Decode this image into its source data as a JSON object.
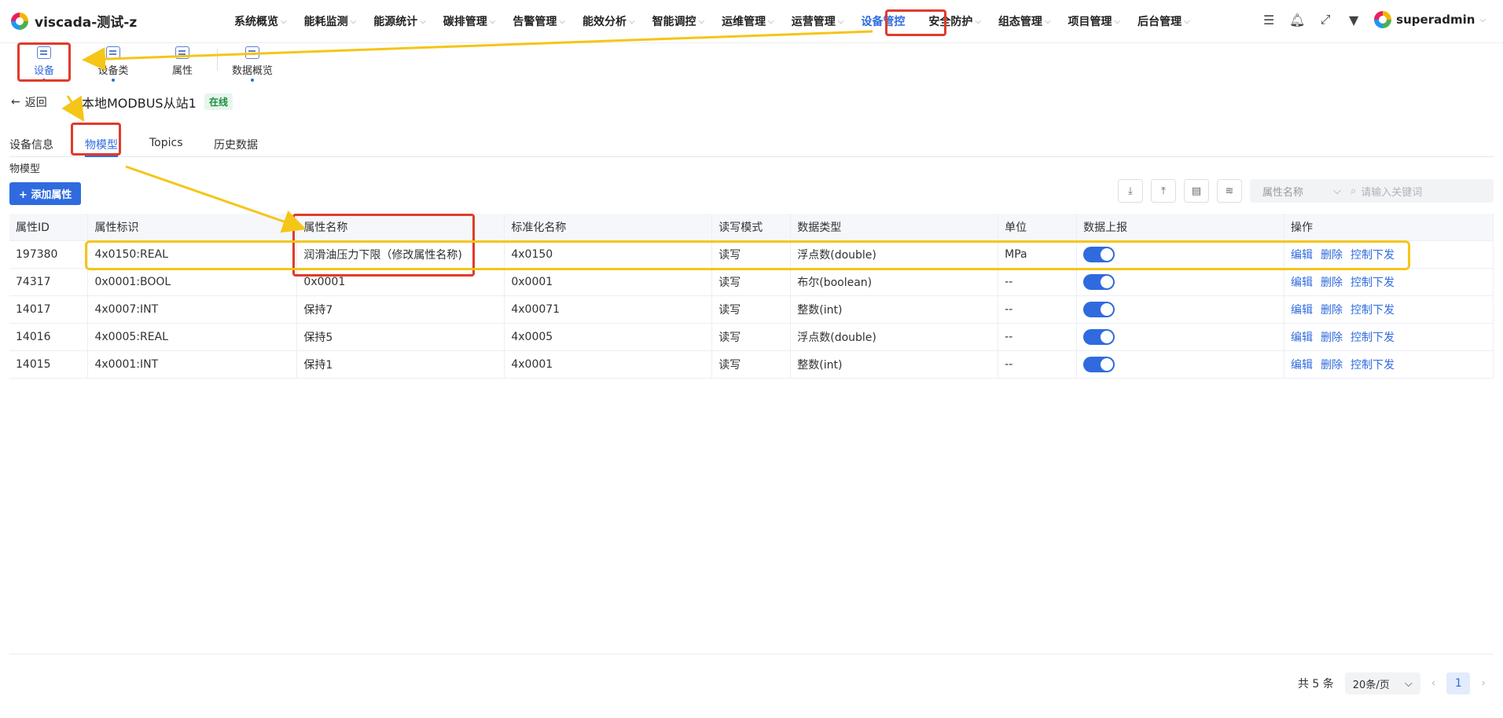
{
  "app": {
    "title": "viscada-测试-z",
    "user": "superadmin"
  },
  "nav": {
    "items": [
      {
        "label": "系统概览",
        "active": false
      },
      {
        "label": "能耗监测",
        "active": false
      },
      {
        "label": "能源统计",
        "active": false
      },
      {
        "label": "碳排管理",
        "active": false
      },
      {
        "label": "告警管理",
        "active": false
      },
      {
        "label": "能效分析",
        "active": false
      },
      {
        "label": "智能调控",
        "active": false
      },
      {
        "label": "运维管理",
        "active": false
      },
      {
        "label": "运营管理",
        "active": false
      },
      {
        "label": "设备管控",
        "active": true
      },
      {
        "label": "安全防护",
        "active": false
      },
      {
        "label": "组态管理",
        "active": false
      },
      {
        "label": "项目管理",
        "active": false
      },
      {
        "label": "后台管理",
        "active": false
      }
    ]
  },
  "subnav": {
    "items": [
      {
        "label": "设备",
        "icon": "device-icon",
        "active": true
      },
      {
        "label": "设备类",
        "icon": "device-class-icon",
        "active": false
      },
      {
        "label": "属性",
        "icon": "attribute-icon",
        "active": false
      },
      {
        "label": "数据概览",
        "icon": "data-overview-icon",
        "active": false
      }
    ]
  },
  "detail": {
    "back_label": "返回",
    "device_name": "本地MODBUS从站1",
    "status": "在线",
    "tabs": [
      {
        "label": "设备信息",
        "active": false
      },
      {
        "label": "物模型",
        "active": true
      },
      {
        "label": "Topics",
        "active": false
      },
      {
        "label": "历史数据",
        "active": false
      }
    ],
    "section_title": "物模型",
    "add_button": "+ 添加属性",
    "search": {
      "field": "属性名称",
      "placeholder": "请输入关键词"
    }
  },
  "table": {
    "headers": [
      "属性ID",
      "属性标识",
      "属性名称",
      "标准化名称",
      "读写模式",
      "数据类型",
      "单位",
      "数据上报",
      "操作"
    ],
    "rows": [
      {
        "id": "197380",
        "ident": "4x0150:REAL",
        "name": "润滑油压力下限（修改属性名称)",
        "std": "4x0150",
        "rw": "读写",
        "type": "浮点数(double)",
        "unit": "MPa",
        "report": true
      },
      {
        "id": "74317",
        "ident": "0x0001:BOOL",
        "name": "0x0001",
        "std": "0x0001",
        "rw": "读写",
        "type": "布尔(boolean)",
        "unit": "--",
        "report": true
      },
      {
        "id": "14017",
        "ident": "4x0007:INT",
        "name": "保持7",
        "std": "4x00071",
        "rw": "读写",
        "type": "整数(int)",
        "unit": "--",
        "report": true
      },
      {
        "id": "14016",
        "ident": "4x0005:REAL",
        "name": "保持5",
        "std": "4x0005",
        "rw": "读写",
        "type": "浮点数(double)",
        "unit": "--",
        "report": true
      },
      {
        "id": "14015",
        "ident": "4x0001:INT",
        "name": "保持1",
        "std": "4x0001",
        "rw": "读写",
        "type": "整数(int)",
        "unit": "--",
        "report": true
      }
    ],
    "actions": {
      "edit": "编辑",
      "delete": "删除",
      "control": "控制下发"
    }
  },
  "pager": {
    "total": "共 5 条",
    "page_size": "20条/页",
    "current": "1"
  },
  "colors": {
    "accent": "#2f6bdf",
    "highlight_red": "#e03b2b",
    "highlight_yellow": "#f5c518",
    "status_green": "#1e8e3e"
  }
}
